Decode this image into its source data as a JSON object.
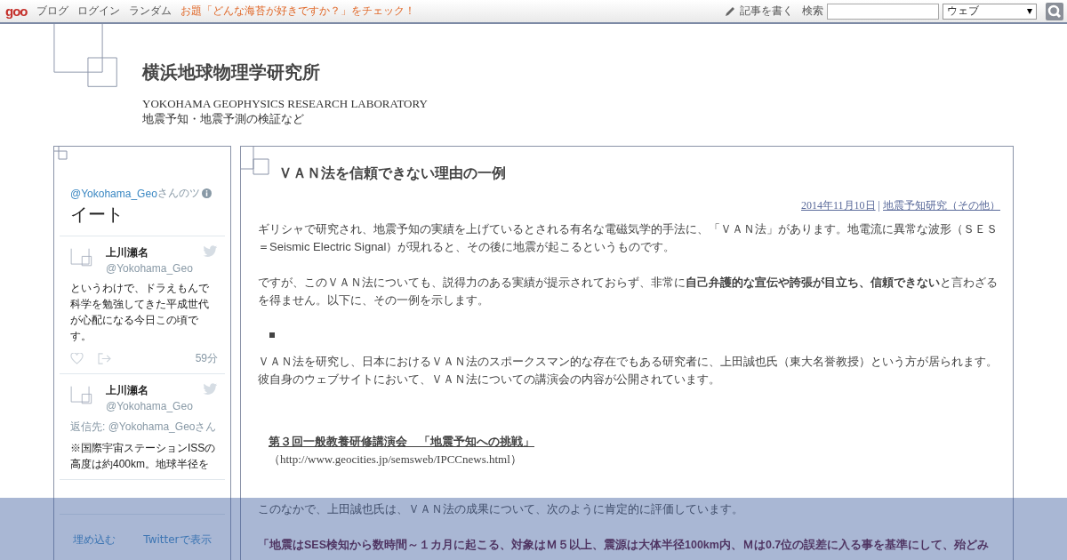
{
  "topbar": {
    "logo": "goo",
    "links": [
      "ブログ",
      "ログイン",
      "ランダム"
    ],
    "notice": "お題「どんな海苔が好きですか？」をチェック！",
    "write": "記事を書く",
    "search_label": "検索",
    "scope": "ウェブ"
  },
  "blog": {
    "title": "横浜地球物理学研究所",
    "subtitle": "YOKOHAMA GEOPHYSICS RESEARCH LABORATORY",
    "description": "地震予知・地震予測の検証など"
  },
  "twitter": {
    "handle": "@Yokohama_Geo",
    "title_rest": "さんのツ",
    "title_line2": "イート",
    "tweets": [
      {
        "name": "上川瀬名",
        "handle": "@Yokohama_Geo",
        "text": "というわけで、ドラえもんで科学を勉強してきた平成世代が心配になる今日この頃です。",
        "time": "59分"
      },
      {
        "name": "上川瀬名",
        "handle": "@Yokohama_Geo",
        "reply_to": "返信先: @Yokohama_Geoさん",
        "text": "※国際宇宙ステーションISSの高度は約400km。地球半径を"
      }
    ],
    "footer": [
      "埋め込む",
      "Twitterで表示"
    ]
  },
  "article": {
    "title": "ＶＡＮ法を信頼できない理由の一例",
    "date": "2014年11月10日",
    "separator": "|",
    "category": "地震予知研究（その他）",
    "blocks": [
      {
        "kind": "para",
        "text": "ギリシャで研究され、地震予知の実績を上げているとされる有名な電磁気学的手法に、「ＶＡＮ法」があります。地電流に異常な波形（ＳＥＳ＝Seismic Electric Signal）が現れると、その後に地震が起こるというものです。"
      },
      {
        "kind": "para",
        "text": "ですが、このＶＡＮ法についても、説得力のある実績が提示されておらず、非常に**自己弁護的な宣伝や誇張が目立ち、信頼できない**と言わざるを得ません。以下に、その一例を示します。"
      },
      {
        "kind": "bullet"
      },
      {
        "kind": "para",
        "text": "ＶＡＮ法を研究し、日本におけるＶＡＮ法のスポークスマン的な存在でもある研究者に、上田誠也氏（東大名誉教授）という方が居られます。彼自身のウェブサイトにおいて、ＶＡＮ法についての講演会の内容が公開されています。"
      },
      {
        "kind": "ref",
        "text": "第３回一般教養研修講演会　「地震予知への挑戦」",
        "url": "（http://www.geocities.jp/semsweb/IPCCnews.html）"
      },
      {
        "kind": "para",
        "text": "このなかで、上田誠也氏は、ＶＡＮ法の成果について、次のように肯定的に評価しています。"
      },
      {
        "kind": "quote",
        "text": "「地震はSES検知から数時間～１カ月に起こる、対象はＭ５以上、震源は大体半径100km内、Ｍは0.7位の誤差に入る事を基準にして、殆どみ"
      }
    ]
  }
}
